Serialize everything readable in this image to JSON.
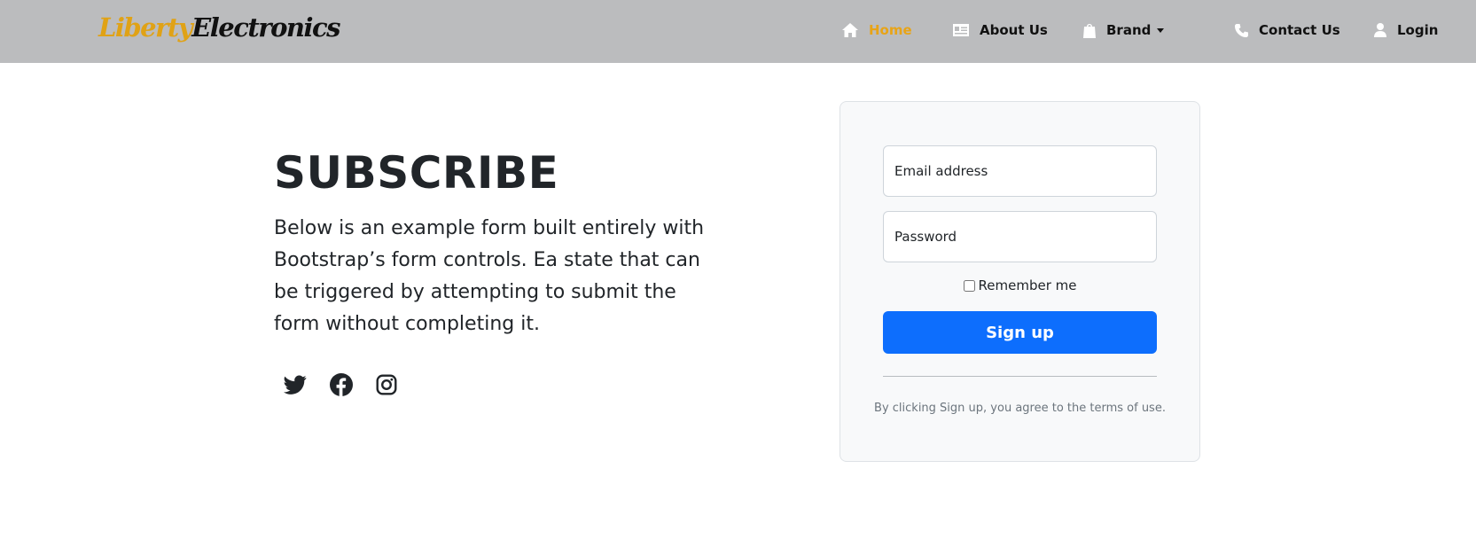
{
  "navbar": {
    "brand_part1": "Liberty",
    "brand_part2": "Electronics",
    "items": [
      {
        "label": "Home",
        "icon": "home-icon",
        "active": true
      },
      {
        "label": "About Us",
        "icon": "id-card-icon"
      },
      {
        "label": "Brand",
        "icon": "shopping-bag-icon",
        "dropdown": true
      },
      {
        "label": "Contact Us",
        "icon": "phone-icon"
      },
      {
        "label": "Login",
        "icon": "user-icon"
      }
    ],
    "active_color": "#e8a417",
    "background": "#bbbcbe"
  },
  "main": {
    "heading": "SUBSCRIBE",
    "lead": "Below is an example form built entirely with Bootstrap’s form controls. Ea state that can be triggered by attempting to submit the form without completing it.",
    "social": [
      {
        "icon": "twitter-icon"
      },
      {
        "icon": "facebook-icon"
      },
      {
        "icon": "instagram-icon"
      }
    ]
  },
  "form": {
    "email_placeholder": "Email address",
    "password_placeholder": "Password",
    "remember_label": "Remember me",
    "remember_checked": false,
    "submit_label": "Sign up",
    "terms_text": "By clicking Sign up, you agree to the terms of use.",
    "accent": "#0d6efd"
  }
}
